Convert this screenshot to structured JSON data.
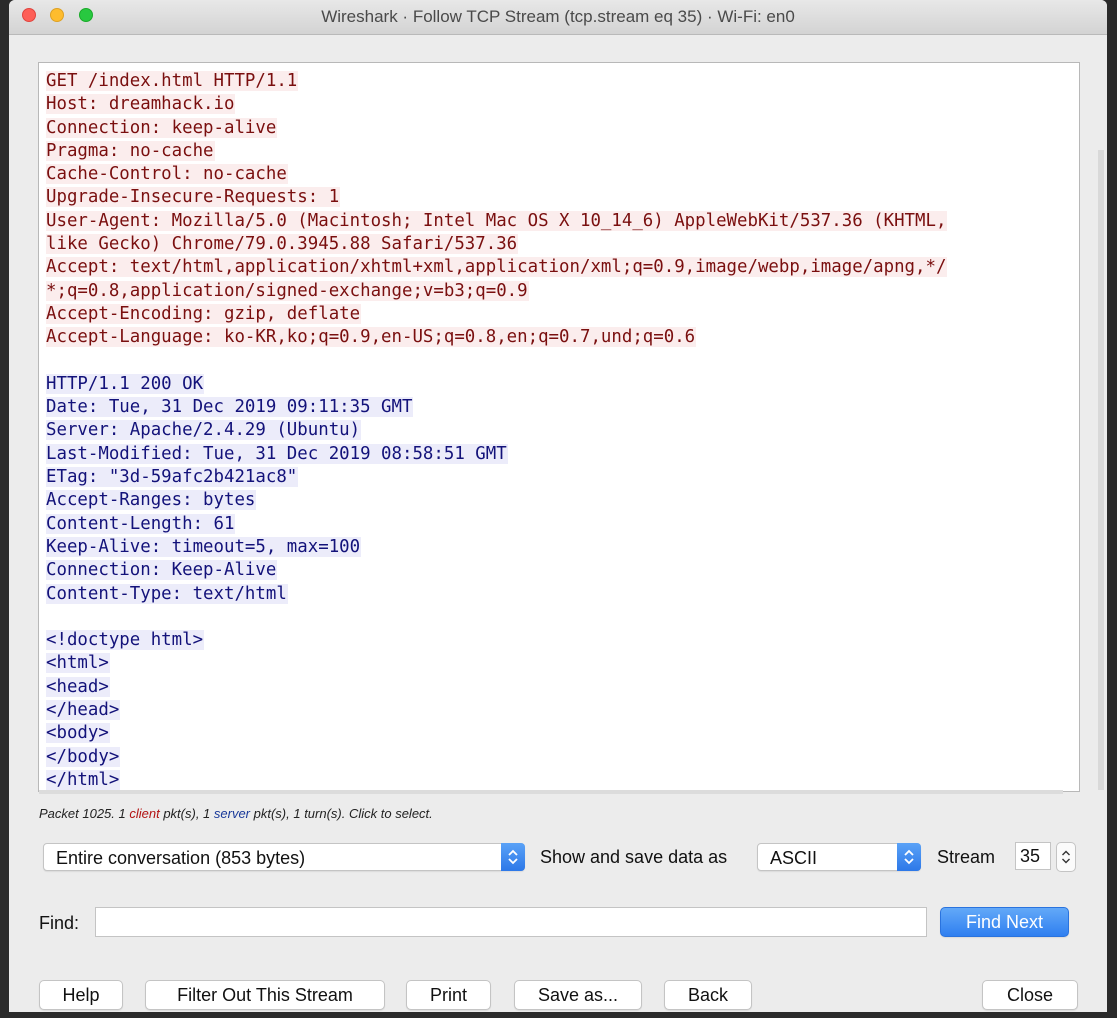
{
  "window": {
    "title": "Wireshark · Follow TCP Stream (tcp.stream eq 35) · Wi-Fi: en0"
  },
  "stream": {
    "lines": [
      {
        "text": "GET /index.html HTTP/1.1",
        "role": "client"
      },
      {
        "text": "Host: dreamhack.io",
        "role": "client"
      },
      {
        "text": "Connection: keep-alive",
        "role": "client"
      },
      {
        "text": "Pragma: no-cache",
        "role": "client"
      },
      {
        "text": "Cache-Control: no-cache",
        "role": "client"
      },
      {
        "text": "Upgrade-Insecure-Requests: 1",
        "role": "client"
      },
      {
        "text": "User-Agent: Mozilla/5.0 (Macintosh; Intel Mac OS X 10_14_6) AppleWebKit/537.36 (KHTML,",
        "role": "client"
      },
      {
        "text": "like Gecko) Chrome/79.0.3945.88 Safari/537.36",
        "role": "client"
      },
      {
        "text": "Accept: text/html,application/xhtml+xml,application/xml;q=0.9,image/webp,image/apng,*/",
        "role": "client"
      },
      {
        "text": "*;q=0.8,application/signed-exchange;v=b3;q=0.9",
        "role": "client"
      },
      {
        "text": "Accept-Encoding: gzip, deflate",
        "role": "client"
      },
      {
        "text": "Accept-Language: ko-KR,ko;q=0.9,en-US;q=0.8,en;q=0.7,und;q=0.6",
        "role": "client"
      },
      {
        "text": "",
        "role": "blank"
      },
      {
        "text": "HTTP/1.1 200 OK",
        "role": "server"
      },
      {
        "text": "Date: Tue, 31 Dec 2019 09:11:35 GMT",
        "role": "server"
      },
      {
        "text": "Server: Apache/2.4.29 (Ubuntu)",
        "role": "server"
      },
      {
        "text": "Last-Modified: Tue, 31 Dec 2019 08:58:51 GMT",
        "role": "server"
      },
      {
        "text": "ETag: \"3d-59afc2b421ac8\"",
        "role": "server"
      },
      {
        "text": "Accept-Ranges: bytes",
        "role": "server"
      },
      {
        "text": "Content-Length: 61",
        "role": "server"
      },
      {
        "text": "Keep-Alive: timeout=5, max=100",
        "role": "server"
      },
      {
        "text": "Connection: Keep-Alive",
        "role": "server"
      },
      {
        "text": "Content-Type: text/html",
        "role": "server"
      },
      {
        "text": "",
        "role": "blank"
      },
      {
        "text": "<!doctype html>",
        "role": "server"
      },
      {
        "text": "<html>",
        "role": "server"
      },
      {
        "text": "<head>",
        "role": "server"
      },
      {
        "text": "</head>",
        "role": "server"
      },
      {
        "text": "<body>",
        "role": "server"
      },
      {
        "text": "</body>",
        "role": "server"
      },
      {
        "text": "</html>",
        "role": "server"
      }
    ]
  },
  "packet_info": {
    "prefix": "Packet 1025. 1 ",
    "client_word": "client",
    "middle": " pkt(s), 1 ",
    "server_word": "server",
    "suffix": " pkt(s), 1 turn(s). Click to select."
  },
  "controls": {
    "conversation_select": "Entire conversation (853 bytes)",
    "show_save_label": "Show and save data as",
    "format_select": "ASCII",
    "stream_label": "Stream",
    "stream_value": "35",
    "find_label": "Find:",
    "find_value": "",
    "find_next_label": "Find Next"
  },
  "buttons": {
    "help": "Help",
    "filter_out": "Filter Out This Stream",
    "print": "Print",
    "save_as": "Save as...",
    "back": "Back",
    "close": "Close"
  },
  "colors": {
    "client_bg": "#fbeded",
    "client_fg": "#7a0f0f",
    "server_bg": "#ececfa",
    "server_fg": "#13127a",
    "accent": "#2f7ff0"
  },
  "icons": {
    "select_arrows": "up-down-chevron-icon",
    "stepper": "stepper-arrows-icon"
  }
}
